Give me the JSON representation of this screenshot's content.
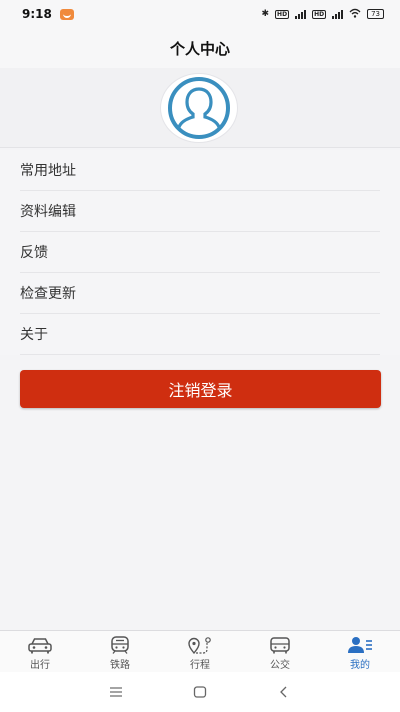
{
  "status_bar": {
    "time": "9:18",
    "battery": "73",
    "network": "4G"
  },
  "header": {
    "title": "个人中心"
  },
  "menu": {
    "items": [
      {
        "label": "常用地址"
      },
      {
        "label": "资料编辑"
      },
      {
        "label": "反馈"
      },
      {
        "label": "检查更新"
      },
      {
        "label": "关于"
      }
    ]
  },
  "logout": {
    "label": "注销登录"
  },
  "tabbar": {
    "tabs": [
      {
        "label": "出行",
        "icon": "car-icon"
      },
      {
        "label": "铁路",
        "icon": "train-icon"
      },
      {
        "label": "行程",
        "icon": "route-icon"
      },
      {
        "label": "公交",
        "icon": "bus-icon"
      },
      {
        "label": "我的",
        "icon": "user-list-icon",
        "active": true
      }
    ]
  },
  "colors": {
    "accent": "#2a6fc2",
    "logout_button": "#cf2e10",
    "avatar": "#3a8fbf"
  }
}
